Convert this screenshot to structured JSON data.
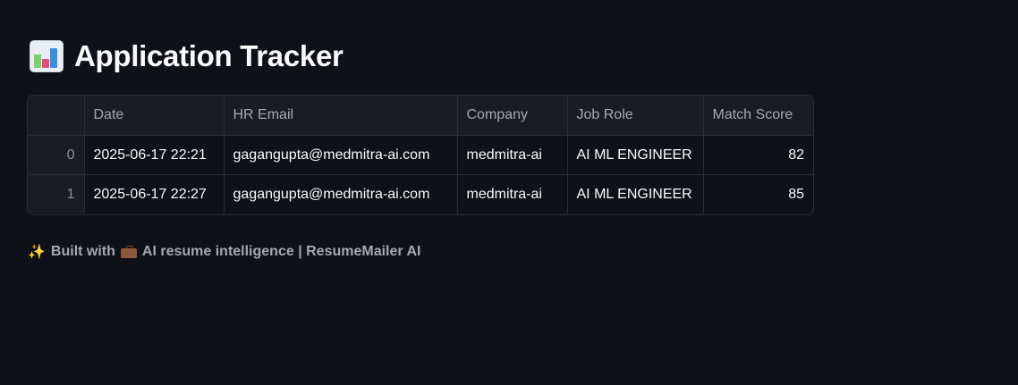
{
  "header": {
    "title": "Application Tracker",
    "icon": "bar-chart-icon"
  },
  "table": {
    "columns": [
      "",
      "Date",
      "HR Email",
      "Company",
      "Job Role",
      "Match Score"
    ],
    "rows": [
      {
        "index": "0",
        "date": "2025-06-17 22:21",
        "hr_email": "gagangupta@medmitra-ai.com",
        "company": "medmitra-ai",
        "job_role": "AI ML ENGINEER",
        "match_score": "82"
      },
      {
        "index": "1",
        "date": "2025-06-17 22:27",
        "hr_email": "gagangupta@medmitra-ai.com",
        "company": "medmitra-ai",
        "job_role": "AI ML ENGINEER",
        "match_score": "85"
      }
    ]
  },
  "footer": {
    "prefix_icon": "sparkles-icon",
    "built_with": "Built with",
    "middle_icon": "briefcase-icon",
    "text": "AI resume intelligence | ResumeMailer AI"
  },
  "colors": {
    "background": "#0e1117",
    "header_bg": "#1a1c24",
    "border": "#2a2d36",
    "text": "#fafafa",
    "muted": "#a3a8b4"
  }
}
